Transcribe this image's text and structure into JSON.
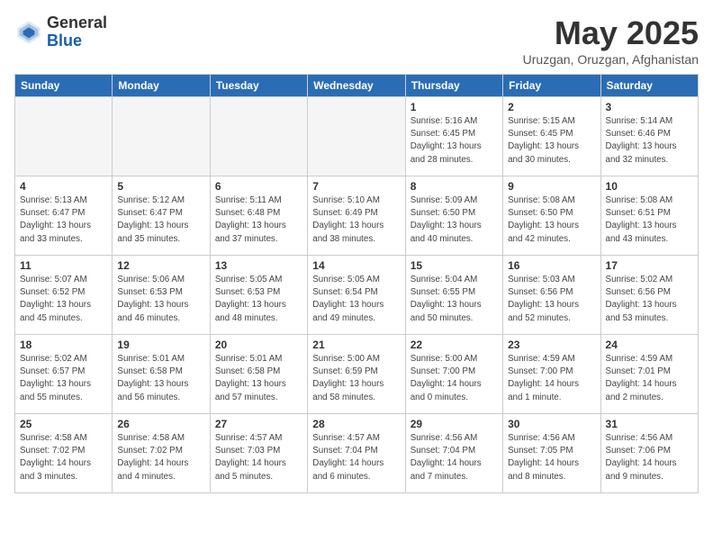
{
  "header": {
    "logo_general": "General",
    "logo_blue": "Blue",
    "month_title": "May 2025",
    "subtitle": "Uruzgan, Oruzgan, Afghanistan"
  },
  "weekdays": [
    "Sunday",
    "Monday",
    "Tuesday",
    "Wednesday",
    "Thursday",
    "Friday",
    "Saturday"
  ],
  "weeks": [
    [
      {
        "date": "",
        "info": ""
      },
      {
        "date": "",
        "info": ""
      },
      {
        "date": "",
        "info": ""
      },
      {
        "date": "",
        "info": ""
      },
      {
        "date": "1",
        "info": "Sunrise: 5:16 AM\nSunset: 6:45 PM\nDaylight: 13 hours\nand 28 minutes."
      },
      {
        "date": "2",
        "info": "Sunrise: 5:15 AM\nSunset: 6:45 PM\nDaylight: 13 hours\nand 30 minutes."
      },
      {
        "date": "3",
        "info": "Sunrise: 5:14 AM\nSunset: 6:46 PM\nDaylight: 13 hours\nand 32 minutes."
      }
    ],
    [
      {
        "date": "4",
        "info": "Sunrise: 5:13 AM\nSunset: 6:47 PM\nDaylight: 13 hours\nand 33 minutes."
      },
      {
        "date": "5",
        "info": "Sunrise: 5:12 AM\nSunset: 6:47 PM\nDaylight: 13 hours\nand 35 minutes."
      },
      {
        "date": "6",
        "info": "Sunrise: 5:11 AM\nSunset: 6:48 PM\nDaylight: 13 hours\nand 37 minutes."
      },
      {
        "date": "7",
        "info": "Sunrise: 5:10 AM\nSunset: 6:49 PM\nDaylight: 13 hours\nand 38 minutes."
      },
      {
        "date": "8",
        "info": "Sunrise: 5:09 AM\nSunset: 6:50 PM\nDaylight: 13 hours\nand 40 minutes."
      },
      {
        "date": "9",
        "info": "Sunrise: 5:08 AM\nSunset: 6:50 PM\nDaylight: 13 hours\nand 42 minutes."
      },
      {
        "date": "10",
        "info": "Sunrise: 5:08 AM\nSunset: 6:51 PM\nDaylight: 13 hours\nand 43 minutes."
      }
    ],
    [
      {
        "date": "11",
        "info": "Sunrise: 5:07 AM\nSunset: 6:52 PM\nDaylight: 13 hours\nand 45 minutes."
      },
      {
        "date": "12",
        "info": "Sunrise: 5:06 AM\nSunset: 6:53 PM\nDaylight: 13 hours\nand 46 minutes."
      },
      {
        "date": "13",
        "info": "Sunrise: 5:05 AM\nSunset: 6:53 PM\nDaylight: 13 hours\nand 48 minutes."
      },
      {
        "date": "14",
        "info": "Sunrise: 5:05 AM\nSunset: 6:54 PM\nDaylight: 13 hours\nand 49 minutes."
      },
      {
        "date": "15",
        "info": "Sunrise: 5:04 AM\nSunset: 6:55 PM\nDaylight: 13 hours\nand 50 minutes."
      },
      {
        "date": "16",
        "info": "Sunrise: 5:03 AM\nSunset: 6:56 PM\nDaylight: 13 hours\nand 52 minutes."
      },
      {
        "date": "17",
        "info": "Sunrise: 5:02 AM\nSunset: 6:56 PM\nDaylight: 13 hours\nand 53 minutes."
      }
    ],
    [
      {
        "date": "18",
        "info": "Sunrise: 5:02 AM\nSunset: 6:57 PM\nDaylight: 13 hours\nand 55 minutes."
      },
      {
        "date": "19",
        "info": "Sunrise: 5:01 AM\nSunset: 6:58 PM\nDaylight: 13 hours\nand 56 minutes."
      },
      {
        "date": "20",
        "info": "Sunrise: 5:01 AM\nSunset: 6:58 PM\nDaylight: 13 hours\nand 57 minutes."
      },
      {
        "date": "21",
        "info": "Sunrise: 5:00 AM\nSunset: 6:59 PM\nDaylight: 13 hours\nand 58 minutes."
      },
      {
        "date": "22",
        "info": "Sunrise: 5:00 AM\nSunset: 7:00 PM\nDaylight: 14 hours\nand 0 minutes."
      },
      {
        "date": "23",
        "info": "Sunrise: 4:59 AM\nSunset: 7:00 PM\nDaylight: 14 hours\nand 1 minute."
      },
      {
        "date": "24",
        "info": "Sunrise: 4:59 AM\nSunset: 7:01 PM\nDaylight: 14 hours\nand 2 minutes."
      }
    ],
    [
      {
        "date": "25",
        "info": "Sunrise: 4:58 AM\nSunset: 7:02 PM\nDaylight: 14 hours\nand 3 minutes."
      },
      {
        "date": "26",
        "info": "Sunrise: 4:58 AM\nSunset: 7:02 PM\nDaylight: 14 hours\nand 4 minutes."
      },
      {
        "date": "27",
        "info": "Sunrise: 4:57 AM\nSunset: 7:03 PM\nDaylight: 14 hours\nand 5 minutes."
      },
      {
        "date": "28",
        "info": "Sunrise: 4:57 AM\nSunset: 7:04 PM\nDaylight: 14 hours\nand 6 minutes."
      },
      {
        "date": "29",
        "info": "Sunrise: 4:56 AM\nSunset: 7:04 PM\nDaylight: 14 hours\nand 7 minutes."
      },
      {
        "date": "30",
        "info": "Sunrise: 4:56 AM\nSunset: 7:05 PM\nDaylight: 14 hours\nand 8 minutes."
      },
      {
        "date": "31",
        "info": "Sunrise: 4:56 AM\nSunset: 7:06 PM\nDaylight: 14 hours\nand 9 minutes."
      }
    ]
  ]
}
